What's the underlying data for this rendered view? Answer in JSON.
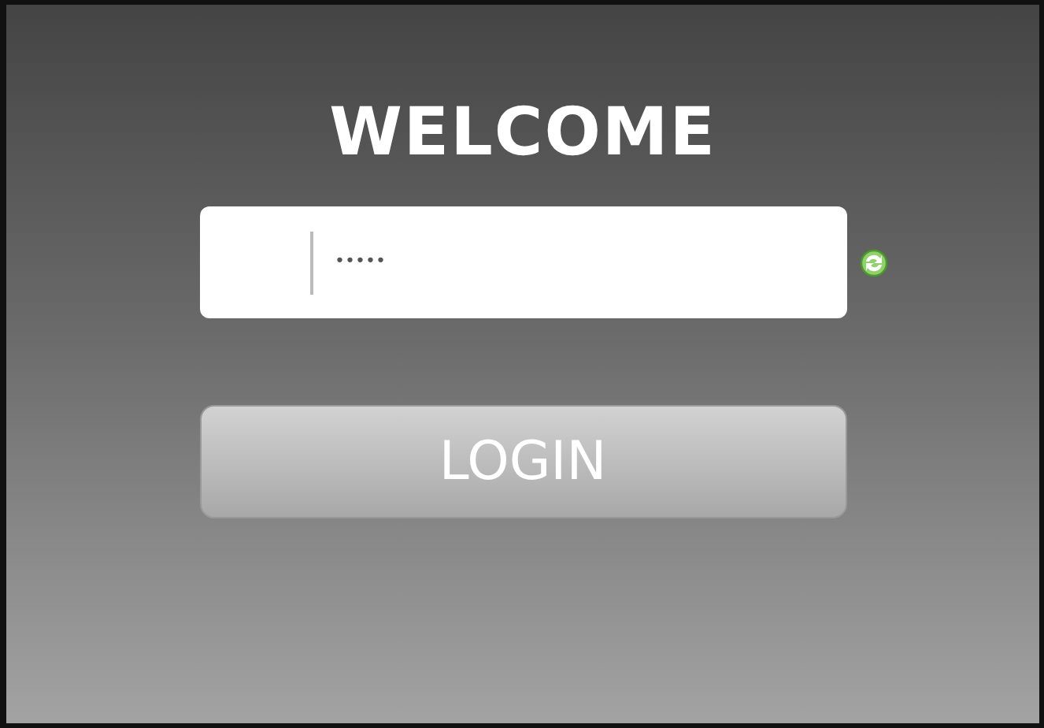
{
  "title": "WELCOME",
  "password_field": {
    "value": "•••••"
  },
  "login_button": {
    "label": "LOGIN"
  }
}
